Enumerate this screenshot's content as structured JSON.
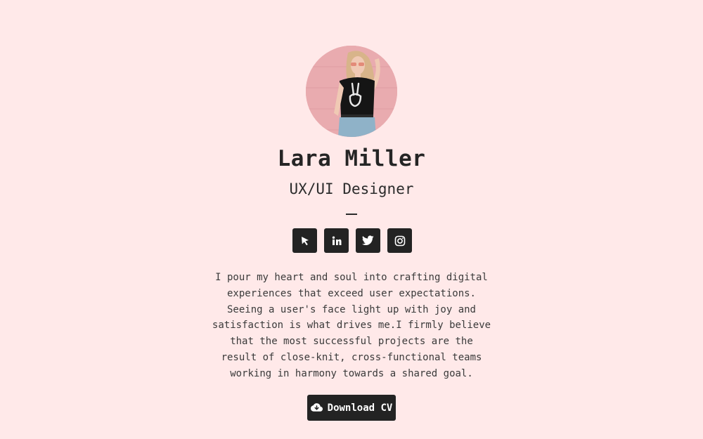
{
  "profile": {
    "name": "Lara Miller",
    "role": "UX/UI Designer",
    "bio": "I pour my heart and soul into crafting digital experiences that exceed user expectations. Seeing a user's face light up with joy and satisfaction is what drives me.I firmly believe that the most successful projects are the result of close-knit, cross-functional teams working in harmony towards a shared goal."
  },
  "socials": [
    {
      "icon": "cursor-pointer-icon"
    },
    {
      "icon": "linkedin-icon"
    },
    {
      "icon": "twitter-icon"
    },
    {
      "icon": "instagram-icon"
    }
  ],
  "cta": {
    "label": "Download CV",
    "icon": "cloud-download-icon"
  },
  "colors": {
    "background": "#ffe9e9",
    "button": "#232323",
    "text": "#2b2b2b"
  }
}
